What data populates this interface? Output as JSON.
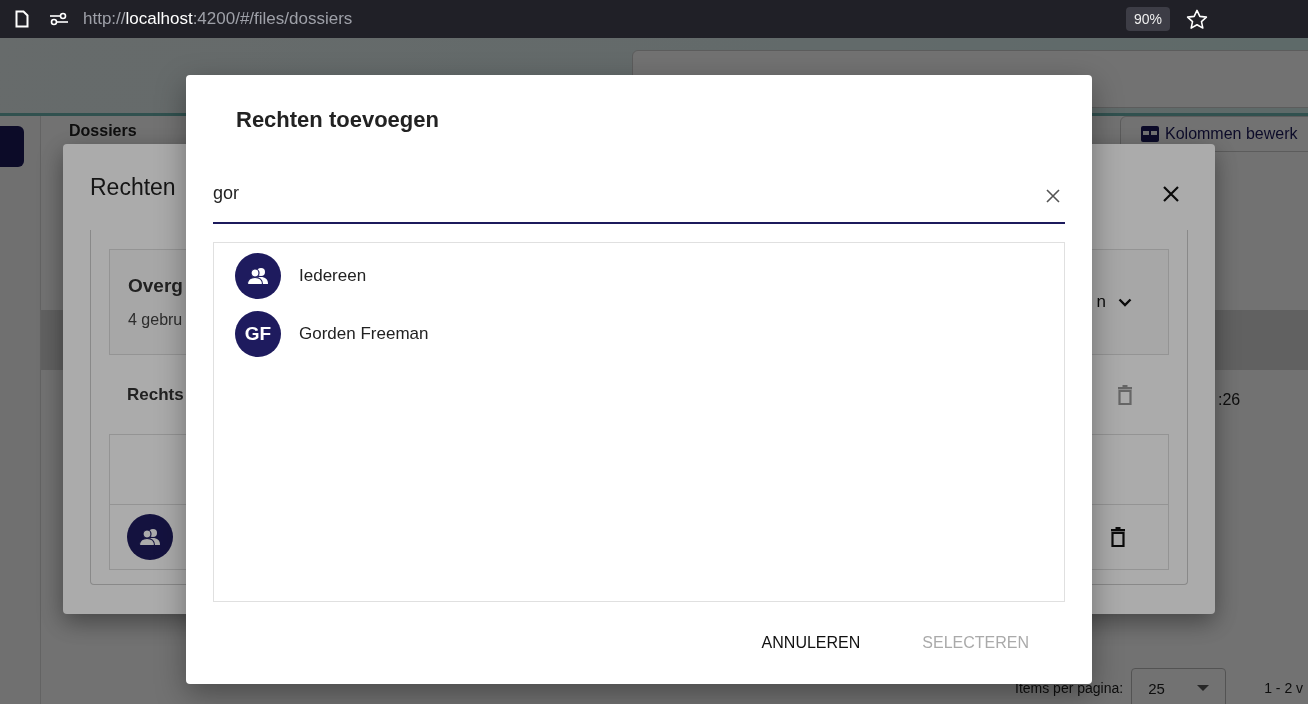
{
  "browser": {
    "url_prefix": "http://",
    "url_host": "localhost",
    "url_suffix": ":4200/#/files/dossiers",
    "zoom": "90%"
  },
  "background": {
    "page_title": "Dossiers",
    "columns_button": "Kolommen bewerk",
    "cell_time": ":26",
    "items_per_page_label": "Items per pagina:",
    "items_per_page": "25",
    "range": "1 - 2 v"
  },
  "permissions_dialog": {
    "title": "Rechten",
    "overview": {
      "title": "Overg",
      "subtitle": "4 gebru",
      "dropdown": "n"
    },
    "rights_heading": "Rechts",
    "heading_delete_disabled": true,
    "rows": [
      {
        "kind": "group",
        "delete_disabled": false
      }
    ]
  },
  "add_dialog": {
    "title": "Rechten toevoegen",
    "search": {
      "value": "gor"
    },
    "results": [
      {
        "kind": "group",
        "name": "Iedereen"
      },
      {
        "kind": "initials",
        "initials": "GF",
        "name": "Gorden Freeman"
      }
    ],
    "buttons": [
      {
        "label": "ANNULEREN",
        "disabled": false
      },
      {
        "label": "SELECTEREN",
        "disabled": true
      }
    ]
  }
}
